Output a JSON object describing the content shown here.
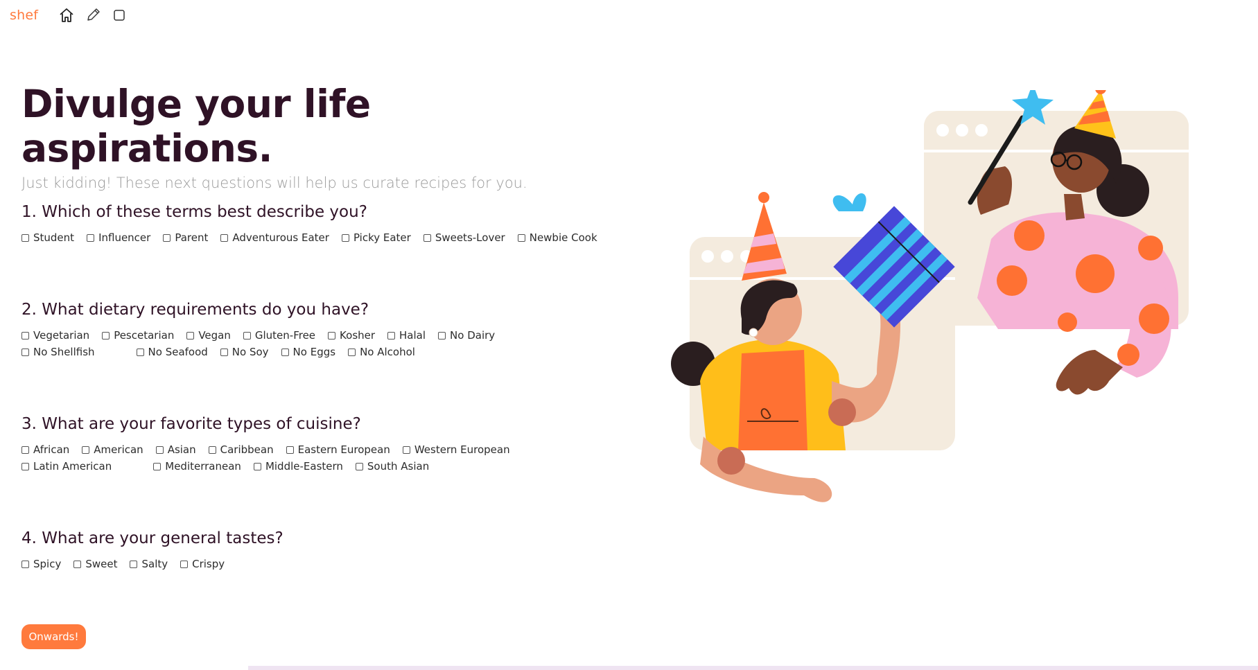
{
  "nav": {
    "brand": "shef",
    "icons": [
      "home-icon",
      "pencil-icon",
      "square-icon"
    ]
  },
  "header": {
    "title": "Divulge your life aspirations.",
    "subtitle": "Just kidding! These next questions will help us curate recipes for you."
  },
  "questions": [
    {
      "title": "1. Which of these terms best describe you?",
      "options": [
        "Student",
        "Influencer",
        "Parent",
        "Adventurous Eater",
        "Picky Eater",
        "Sweets-Lover",
        "Newbie Cook"
      ]
    },
    {
      "title": "2. What dietary requirements do you have?",
      "options": [
        "Vegetarian",
        "Pescetarian",
        "Vegan",
        "Gluten-Free",
        "Kosher",
        "Halal",
        "No Dairy",
        "No Shellfish",
        "No Seafood",
        "No Soy",
        "No Eggs",
        "No Alcohol"
      ]
    },
    {
      "title": "3. What are your favorite types of cuisine?",
      "options": [
        "African",
        "American",
        "Asian",
        "Caribbean",
        "Eastern European",
        "Western European",
        "Latin American",
        "Mediterranean",
        "Middle-Eastern",
        "South Asian"
      ]
    },
    {
      "title": "4. What are your general tastes?",
      "options": [
        "Spicy",
        "Sweet",
        "Salty",
        "Crispy"
      ]
    }
  ],
  "submit": {
    "label": "Onwards!"
  },
  "colors": {
    "accent": "#ff7a3d",
    "title": "#2f1226",
    "subtitle": "#9a9a9a"
  }
}
